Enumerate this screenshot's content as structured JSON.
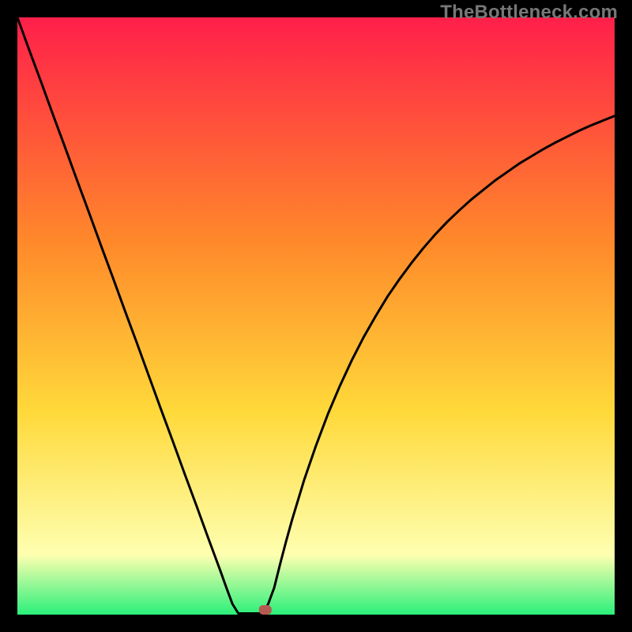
{
  "watermark": "TheBottleneck.com",
  "colors": {
    "black": "#000000",
    "marker": "#b55a53",
    "curve": "#000000",
    "grad_top": "#ff1f4a",
    "grad_mid1": "#ff8a2a",
    "grad_mid2": "#ffd93a",
    "grad_mid3": "#feffb0",
    "grad_bottom": "#2af07a"
  },
  "chart_data": {
    "type": "line",
    "title": "",
    "xlabel": "",
    "ylabel": "",
    "xlim": [
      0,
      100
    ],
    "ylim": [
      0,
      100
    ],
    "grid": false,
    "legend": false,
    "x": [
      0,
      2,
      4,
      6,
      8,
      10,
      12,
      14,
      16,
      18,
      20,
      22,
      24,
      26,
      28,
      30,
      32,
      33,
      34,
      35,
      36,
      37,
      38,
      39,
      40,
      41,
      42,
      43,
      44,
      45,
      46,
      48,
      50,
      52,
      54,
      56,
      58,
      60,
      62,
      64,
      66,
      68,
      70,
      72,
      74,
      76,
      78,
      80,
      82,
      84,
      86,
      88,
      90,
      92,
      94,
      96,
      98,
      100
    ],
    "series": [
      {
        "name": "curve",
        "values": [
          100,
          94.5,
          89.1,
          83.6,
          78.2,
          72.7,
          67.3,
          61.8,
          56.4,
          50.9,
          45.5,
          40.0,
          34.5,
          29.1,
          23.6,
          18.2,
          12.7,
          10.0,
          7.3,
          4.5,
          1.8,
          0.2,
          0.2,
          0.2,
          0.2,
          0.2,
          1.8,
          4.5,
          8.5,
          12.3,
          15.9,
          22.5,
          28.3,
          33.6,
          38.3,
          42.6,
          46.5,
          50.0,
          53.3,
          56.2,
          58.9,
          61.4,
          63.7,
          65.8,
          67.7,
          69.5,
          71.1,
          72.7,
          74.1,
          75.5,
          76.7,
          77.9,
          79.0,
          80.0,
          81.0,
          81.9,
          82.7,
          83.5
        ]
      }
    ],
    "marker": {
      "x": 41.5,
      "y": 0.8
    }
  }
}
